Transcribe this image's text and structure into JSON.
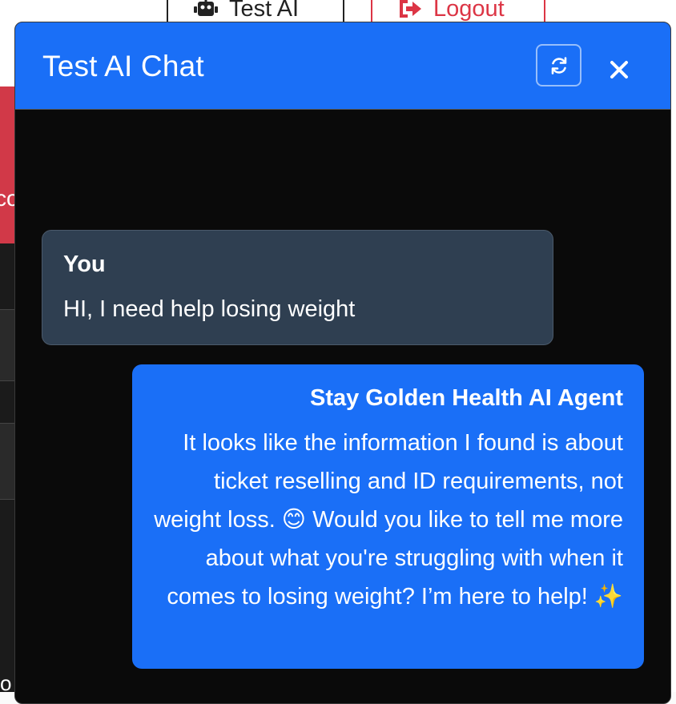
{
  "topnav": {
    "test_ai_label": "Test AI",
    "logout_label": "Logout"
  },
  "background": {
    "left_red_text": "co",
    "left_bottom_text": "o"
  },
  "chat": {
    "title": "Test AI Chat",
    "refresh_icon": "refresh-icon",
    "close_icon": "close-icon",
    "messages": [
      {
        "sender": "You",
        "text": "HI, I need help losing weight",
        "role": "user"
      },
      {
        "sender": "Stay Golden Health AI Agent",
        "text": "It looks like the information I found is about ticket reselling and ID requirements, not weight loss. 😊 Would you like to tell me more about what you're struggling with when it comes to losing weight? I’m here to help! ✨",
        "role": "agent"
      }
    ]
  },
  "colors": {
    "header_blue": "#1a6ff7",
    "user_bubble": "#2f3f51",
    "agent_bubble": "#1a6ff7",
    "modal_bg": "#0a0a0a",
    "logout_red": "#dc3545"
  }
}
